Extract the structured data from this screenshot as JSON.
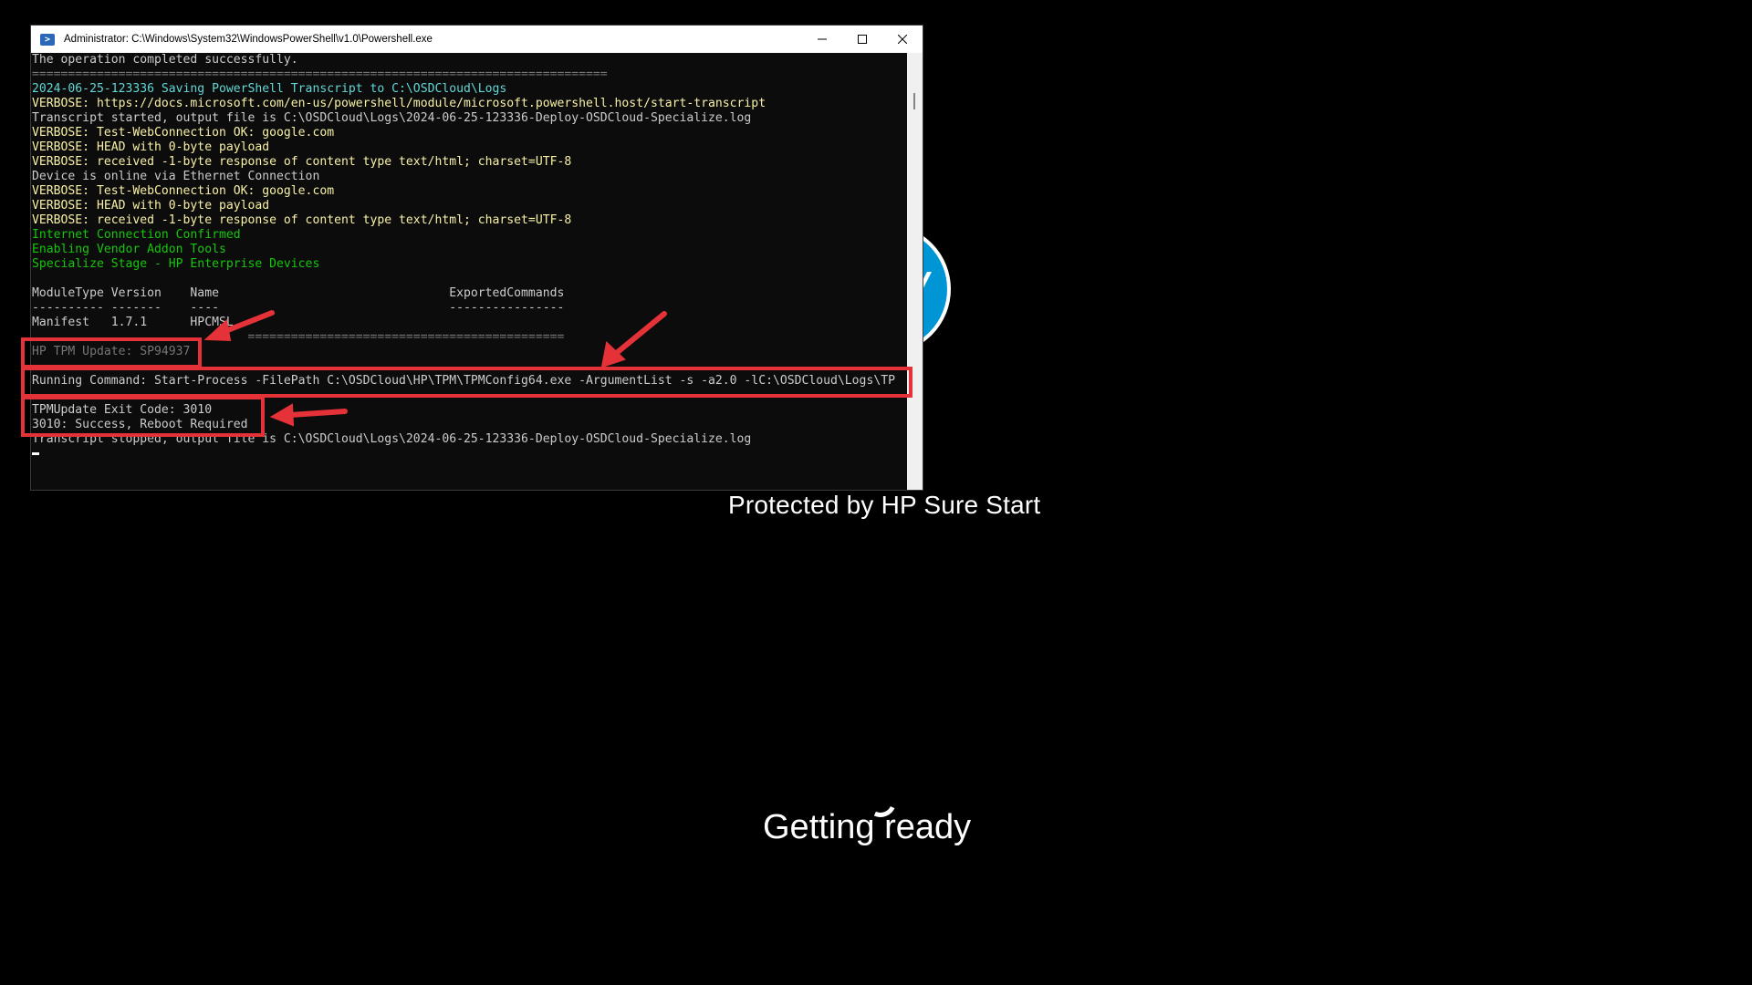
{
  "window": {
    "title": "Administrator: C:\\Windows\\System32\\WindowsPowerShell\\v1.0\\Powershell.exe"
  },
  "console_lines": [
    {
      "text": "The operation completed successfully.",
      "color": "white"
    },
    {
      "text": "================================================================================",
      "color": "gray"
    },
    {
      "text": "2024-06-25-123336 Saving PowerShell Transcript to C:\\OSDCloud\\Logs",
      "color": "cyan"
    },
    {
      "text": "VERBOSE: https://docs.microsoft.com/en-us/powershell/module/microsoft.powershell.host/start-transcript",
      "color": "yellow"
    },
    {
      "text": "Transcript started, output file is C:\\OSDCloud\\Logs\\2024-06-25-123336-Deploy-OSDCloud-Specialize.log",
      "color": "white"
    },
    {
      "text": "VERBOSE: Test-WebConnection OK: google.com",
      "color": "yellow"
    },
    {
      "text": "VERBOSE: HEAD with 0-byte payload",
      "color": "yellow"
    },
    {
      "text": "VERBOSE: received -1-byte response of content type text/html; charset=UTF-8",
      "color": "yellow"
    },
    {
      "text": "Device is online via Ethernet Connection",
      "color": "white"
    },
    {
      "text": "VERBOSE: Test-WebConnection OK: google.com",
      "color": "yellow"
    },
    {
      "text": "VERBOSE: HEAD with 0-byte payload",
      "color": "yellow"
    },
    {
      "text": "VERBOSE: received -1-byte response of content type text/html; charset=UTF-8",
      "color": "yellow"
    },
    {
      "text": "Internet Connection Confirmed",
      "color": "green"
    },
    {
      "text": "Enabling Vendor Addon Tools",
      "color": "green"
    },
    {
      "text": "Specialize Stage - HP Enterprise Devices",
      "color": "green"
    },
    {
      "text": "",
      "color": "white"
    },
    {
      "text": "ModuleType Version    Name                                ExportedCommands",
      "color": "white"
    },
    {
      "text": "---------- -------    ----                                ----------------",
      "color": "white"
    },
    {
      "text": "Manifest   1.7.1      HPCMSL",
      "color": "white"
    },
    {
      "text": "                              ============================================",
      "color": "gray"
    },
    {
      "text": "HP TPM Update: SP94937",
      "color": "gray"
    },
    {
      "text": "",
      "color": "white"
    },
    {
      "text": "Running Command: Start-Process -FilePath C:\\OSDCloud\\HP\\TPM\\TPMConfig64.exe -ArgumentList -s -a2.0 -lC:\\OSDCloud\\Logs\\TP",
      "color": "white"
    },
    {
      "text": "",
      "color": "white"
    },
    {
      "text": "TPMUpdate Exit Code: 3010",
      "color": "white"
    },
    {
      "text": "3010: Success, Reboot Required",
      "color": "white"
    },
    {
      "text": "Transcript stopped, output file is C:\\OSDCloud\\Logs\\2024-06-25-123336-Deploy-OSDCloud-Specialize.log",
      "color": "white"
    }
  ],
  "boot_screen": {
    "protected_text": "Protected by HP Sure Start",
    "status_text": "Getting ready"
  },
  "colors": {
    "annotation_red": "#e53238",
    "hp_blue": "#0096d6"
  }
}
